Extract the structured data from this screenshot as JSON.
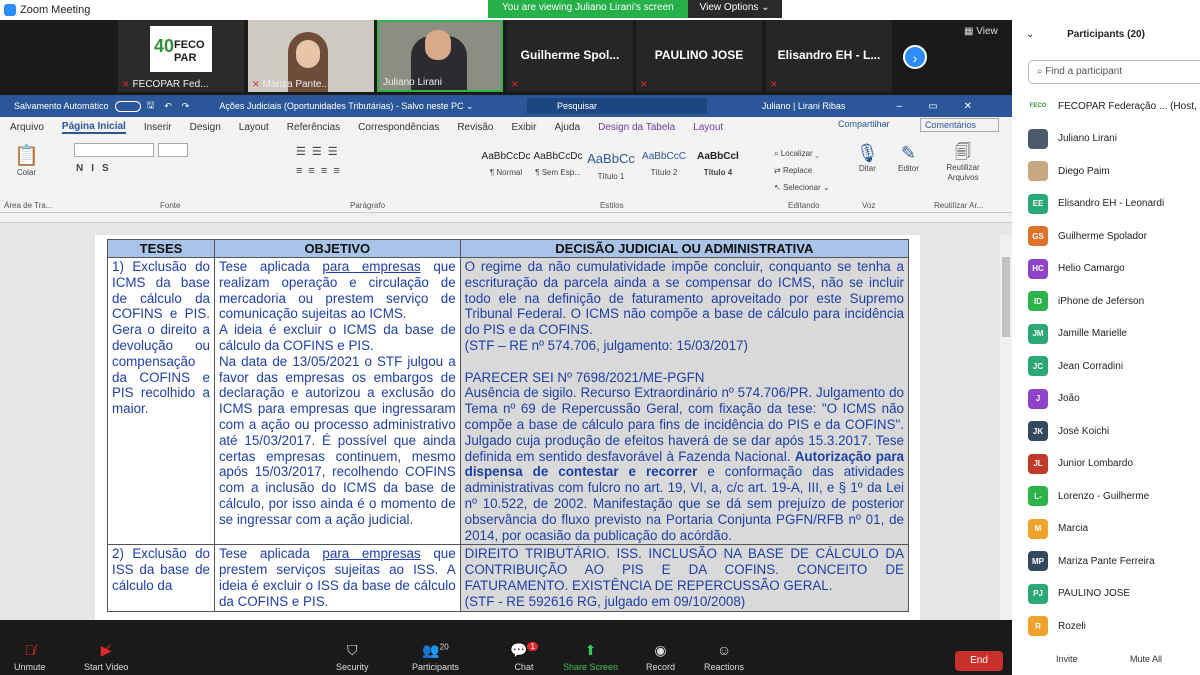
{
  "window": {
    "title": "Zoom Meeting"
  },
  "banner": {
    "viewing": "You are viewing Juliano Lirani's screen",
    "view_options": "View Options ⌄"
  },
  "thumbnails": [
    {
      "name": "FECOPAR Fed...",
      "logo_text": "40 FECO PAR"
    },
    {
      "name": "Mariza Pante..."
    },
    {
      "name": "Juliano Lirani"
    },
    {
      "name": "Guilherme Spol..."
    },
    {
      "name": "PAULINO JOSE"
    },
    {
      "name": "Elisandro EH - L..."
    }
  ],
  "view_label": "View",
  "word": {
    "autosave": "Salvamento Automático",
    "doc_title": "Ações Judiciais (Oportunidades Tributárias)  -  Salvo neste PC ⌄",
    "search": "Pesquisar",
    "user": "Juliano | Lirani Ribas",
    "menu": [
      "Arquivo",
      "Página Inicial",
      "Inserir",
      "Design",
      "Layout",
      "Referências",
      "Correspondências",
      "Revisão",
      "Exibir",
      "Ajuda",
      "Design da Tabela",
      "Layout"
    ],
    "share": "Compartilhar",
    "comments": "Comentários",
    "ribbon": {
      "paste": "Colar",
      "clipboard": "Área de Tra...",
      "font": "Fonte",
      "paragraph": "Parágrafo",
      "styles": "Estilos",
      "style_items": [
        {
          "sample": "AaBbCcDc",
          "name": "¶ Normal"
        },
        {
          "sample": "AaBbCcDc",
          "name": "¶ Sem Esp..."
        },
        {
          "sample": "AaBbCc",
          "name": "Título 1"
        },
        {
          "sample": "AaBbCcC",
          "name": "Título 2"
        },
        {
          "sample": "AaBbCcl",
          "name": "Título 4"
        }
      ],
      "find": "Localizar ⌄",
      "replace": "Replace",
      "select": "Selecionar ⌄",
      "editing": "Editando",
      "dictate": "Ditar",
      "voice": "Voz",
      "editor": "Editor",
      "reuse": "Reutilizar Arquivos",
      "reuse_group": "Reutilizar Ar..."
    },
    "table": {
      "headers": [
        "TESES",
        "OBJETIVO",
        "DECISÃO JUDICIAL OU ADMINISTRATIVA"
      ],
      "row1": {
        "tese": "1) Exclusão do ICMS da base de cálculo da COFINS e PIS. Gera o direito a devolução ou compensação da COFINS e PIS recolhido a maior.",
        "obj_a": "Tese aplicada ",
        "obj_link": "para empresas",
        "obj_b": " que realizam operação e circulação de mercadoria ou prestem serviço de comunicação sujeitas ao ICMS.",
        "obj_c": "A ideia é excluir o ICMS da base de cálculo da COFINS e PIS.",
        "obj_d": "Na data de 13/05/2021 o STF julgou a favor das empresas os embargos de declaração e autorizou a exclusão do ICMS para empresas que ingressaram com a ação ou processo administrativo até 15/03/2017. É possível que ainda certas empresas continuem, mesmo após 15/03/2017, recolhendo COFINS com a inclusão do ICMS da base de cálculo, por isso ainda é o momento de se ingressar com a ação judicial.",
        "dec_a": "O regime da não cumulatividade impõe concluir, conquanto se tenha a escrituração da parcela ainda a se compensar do ICMS, não se incluir todo ele na definição de faturamento aproveitado por este Supremo Tribunal Federal. O ICMS não compõe a base de cálculo para incidência do PIS e da COFINS.",
        "dec_b": "(STF – RE nº 574.706, julgamento: 15/03/2017)",
        "dec_c": "PARECER SEI Nº 7698/2021/ME-PGFN",
        "dec_d": "Ausência de sigilo. Recurso Extraordinário nº 574.706/PR. Julgamento do Tema nº 69 de Repercussão Geral, com fixação da tese: \"O ICMS não compõe a base de cálculo para fins de incidência do PIS e da COFINS\". Julgado cuja produção de efeitos haverá de se dar após 15.3.2017. Tese definida em sentido desfavorável à Fazenda Nacional.",
        "dec_bold": "Autorização para dispensa de contestar e recorrer",
        "dec_e": " e conformação das atividades administrativas com fulcro no art. 19, VI, a, c/c art. 19-A, III, e § 1º da Lei nº 10.522, de 2002. Manifestação que se dá sem prejuízo de posterior observância do fluxo previsto na Portaria Conjunta PGFN/RFB nº 01, de 2014, por ocasião da publicação do acórdão."
      },
      "row2": {
        "tese": "2) Exclusão do ISS da base de cálculo da",
        "obj_a": "Tese aplicada ",
        "obj_link": "para empresas",
        "obj_b": " que prestem serviços sujeitas ao ISS. A ideia é excluir o ISS da base de cálculo da COFINS e PIS.",
        "dec_a": "DIREITO TRIBUTÁRIO. ISS. INCLUSÃO NA BASE DE CÁLCULO DA CONTRIBUIÇÃO AO PIS E DA COFINS. CONCEITO DE FATURAMENTO. EXISTÊNCIA DE REPERCUSSÃO GERAL.",
        "dec_b": "(STF - RE 592616 RG, julgado em 09/10/2008)"
      }
    }
  },
  "toolbar": {
    "unmute": "Unmute",
    "start_video": "Start Video",
    "security": "Security",
    "participants": "Participants",
    "participants_count": "20",
    "chat": "Chat",
    "chat_badge": "1",
    "share_screen": "Share Screen",
    "record": "Record",
    "reactions": "Reactions",
    "end": "End"
  },
  "panel": {
    "title": "Participants (20)",
    "search_placeholder": "Find a participant",
    "participants": [
      {
        "name": "FECOPAR Federação ... (Host, m",
        "initials": "",
        "color": "#ffffff",
        "logo": true
      },
      {
        "name": "Juliano Lirani",
        "initials": "",
        "color": "#4a5a6a",
        "live": true
      },
      {
        "name": "Diego Paim",
        "initials": "",
        "color": "#c8a882"
      },
      {
        "name": "Elisandro EH - Leonardi",
        "initials": "EE",
        "color": "#2aa876"
      },
      {
        "name": "Guilherme Spolador",
        "initials": "GS",
        "color": "#e0712a"
      },
      {
        "name": "Helio Camargo",
        "initials": "HC",
        "color": "#8e44c9"
      },
      {
        "name": "iPhone de Jeferson",
        "initials": "ID",
        "color": "#2cb34a"
      },
      {
        "name": "Jamille Marielle",
        "initials": "JM",
        "color": "#2aa876"
      },
      {
        "name": "Jean Corradini",
        "initials": "JC",
        "color": "#2aa876"
      },
      {
        "name": "João",
        "initials": "J",
        "color": "#8e44c9"
      },
      {
        "name": "José Koichi",
        "initials": "JK",
        "color": "#34495e"
      },
      {
        "name": "Junior Lombardo",
        "initials": "JL",
        "color": "#c0392b"
      },
      {
        "name": "Lorenzo - Guilherme",
        "initials": "L-",
        "color": "#2cb34a"
      },
      {
        "name": "Marcia",
        "initials": "M",
        "color": "#f0a32a"
      },
      {
        "name": "Mariza Pante Ferreira",
        "initials": "MP",
        "color": "#34495e"
      },
      {
        "name": "PAULINO JOSE",
        "initials": "PJ",
        "color": "#2aa876"
      },
      {
        "name": "Rozeli",
        "initials": "R",
        "color": "#f0a32a"
      }
    ],
    "invite": "Invite",
    "mute_all": "Mute All"
  }
}
